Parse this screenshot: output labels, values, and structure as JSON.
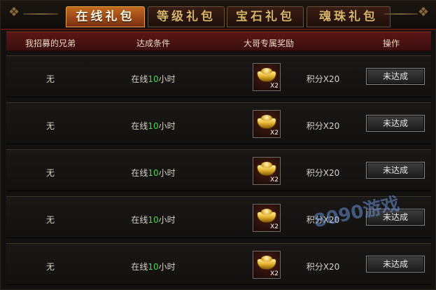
{
  "tabs": [
    {
      "label": "在线礼包",
      "active": true
    },
    {
      "label": "等级礼包",
      "active": false
    },
    {
      "label": "宝石礼包",
      "active": false
    },
    {
      "label": "魂珠礼包",
      "active": false
    }
  ],
  "table": {
    "headers": [
      "我招募的兄弟",
      "达成条件",
      "大哥专属奖励",
      "操作"
    ],
    "rows": [
      {
        "who": "无",
        "cond_pre": "在线",
        "cond_num": "10",
        "cond_post": "小时",
        "reward_qty": "X2",
        "points": "积分X20",
        "action": "未达成"
      },
      {
        "who": "无",
        "cond_pre": "在线",
        "cond_num": "10",
        "cond_post": "小时",
        "reward_qty": "X2",
        "points": "积分X20",
        "action": "未达成"
      },
      {
        "who": "无",
        "cond_pre": "在线",
        "cond_num": "10",
        "cond_post": "小时",
        "reward_qty": "X2",
        "points": "积分X20",
        "action": "未达成"
      },
      {
        "who": "无",
        "cond_pre": "在线",
        "cond_num": "10",
        "cond_post": "小时",
        "reward_qty": "X2",
        "points": "积分X20",
        "action": "未达成"
      },
      {
        "who": "无",
        "cond_pre": "在线",
        "cond_num": "10",
        "cond_post": "小时",
        "reward_qty": "X2",
        "points": "积分X20",
        "action": "未达成"
      }
    ]
  },
  "icons": {
    "reward": "gold-ingot-icon",
    "corner": "ornament-corner-icon"
  },
  "colors": {
    "accent_tab": "#c2691f",
    "header_bg": "#5a1716",
    "highlight_number": "#46d84a"
  },
  "watermark": "8090游戏"
}
